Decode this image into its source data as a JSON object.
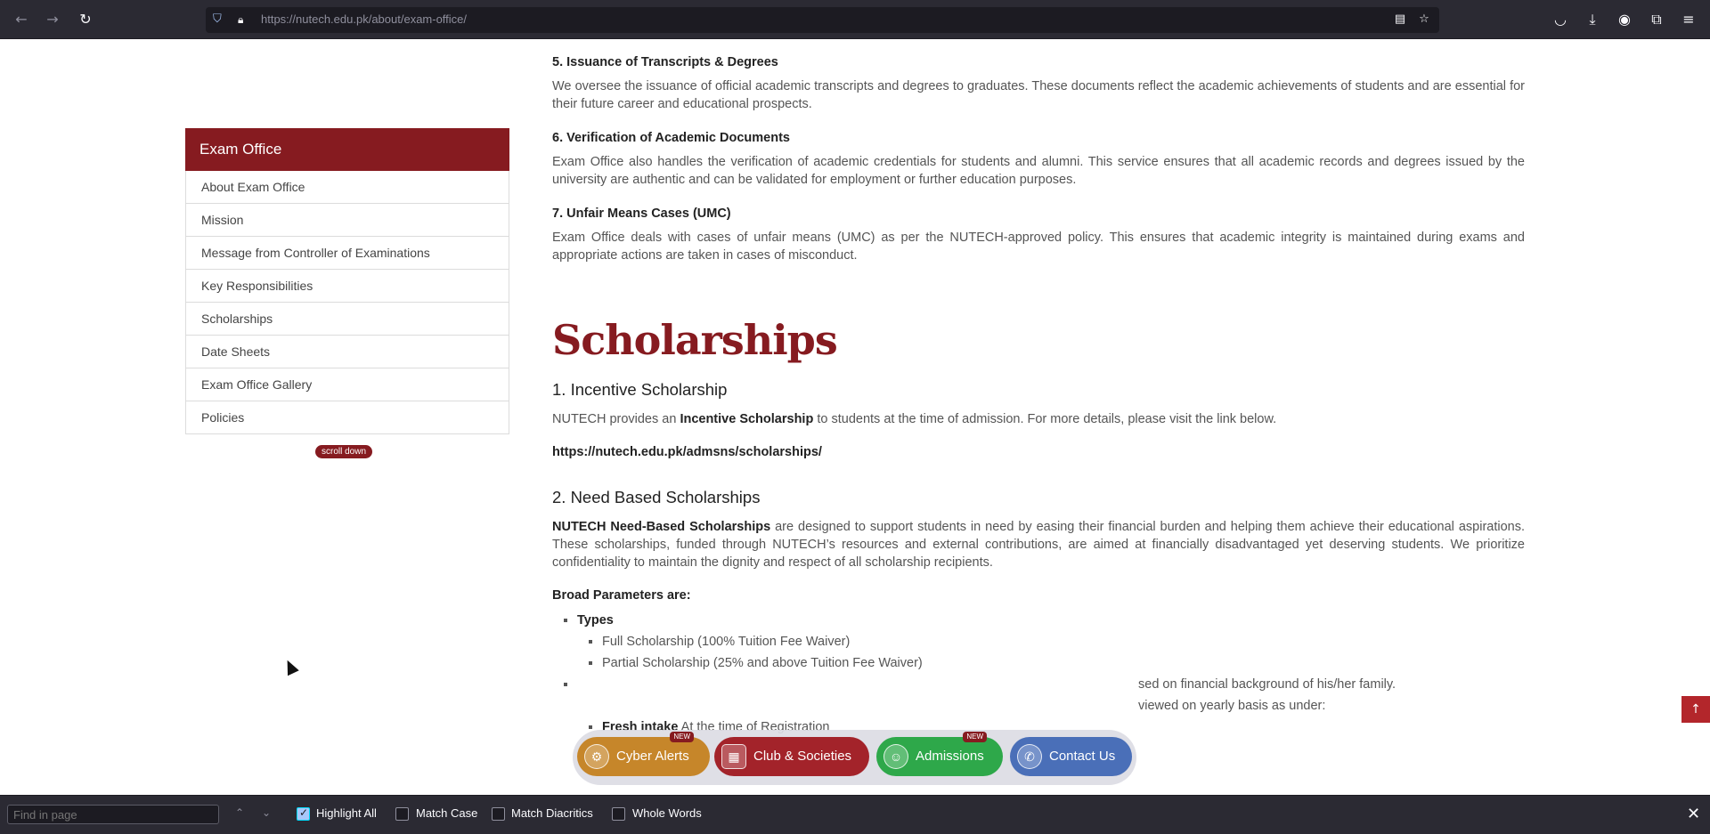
{
  "browser": {
    "url_host": "https://nutech.edu.pk",
    "url_path": "/about/exam-office/",
    "icons": [
      "back-icon",
      "forward-icon",
      "reload-icon",
      "shield-icon",
      "lock-icon",
      "reader-icon",
      "bookmark-star-icon",
      "pocket-icon",
      "download-icon",
      "account-icon",
      "extensions-icon",
      "menu-icon"
    ]
  },
  "sidebar": {
    "title": "Exam Office",
    "items": [
      {
        "label": "About Exam Office"
      },
      {
        "label": "Mission"
      },
      {
        "label": "Message from Controller of Examinations"
      },
      {
        "label": "Key Responsibilities"
      },
      {
        "label": "Scholarships"
      },
      {
        "label": "Date Sheets"
      },
      {
        "label": "Exam Office Gallery"
      },
      {
        "label": "Policies"
      }
    ],
    "scroll_pill": "scroll down"
  },
  "content": {
    "sec5_title": "5. Issuance of Transcripts & Degrees",
    "sec5_text": "We oversee the issuance of official academic transcripts and degrees to graduates. These documents reflect the academic achievements of students and are essential for their future career and educational prospects.",
    "sec6_title": "6. Verification of Academic Documents",
    "sec6_text": "Exam Office also handles the verification of academic credentials for students and alumni. This service ensures that all academic records and degrees issued by the university are authentic and can be validated for employment or further education purposes.",
    "sec7_title": "7. Unfair Means Cases (UMC)",
    "sec7_text": "Exam Office deals with cases of unfair means (UMC) as per the NUTECH-approved policy. This ensures that academic integrity is maintained during exams and appropriate actions are taken in cases of misconduct.",
    "scholarships_title": "Scholarships",
    "incentive_title": "1. Incentive Scholarship",
    "incentive_pre": "NUTECH provides an ",
    "incentive_bold": "Incentive Scholarship",
    "incentive_post": " to students at the time of admission. For more details, please visit the link below.",
    "incentive_link": "https://nutech.edu.pk/admsns/scholarships/",
    "need_title": "2. Need Based Scholarships",
    "need_bold": "NUTECH Need-Based Scholarships",
    "need_text": " are designed to support students in need by easing their financial burden and helping them achieve their educational aspirations. These scholarships, funded through NUTECH’s resources and external contributions, are aimed at financially disadvantaged yet deserving students. We prioritize confidentiality to maintain the dignity and respect of all scholarship recipients.",
    "broad_params": "Broad Parameters are:",
    "types_label": "Types",
    "type_full": "Full Scholarship (100% Tuition Fee Waiver)",
    "type_partial": "Partial Scholarship (25% and above Tuition Fee Waiver)",
    "hidden_line1_tail": "sed on financial background of his/her family.",
    "hidden_line2_tail": "viewed on yearly basis as under:",
    "fresh_intake_bold": "Fresh intake",
    "fresh_intake_rest": " At the time of Registration"
  },
  "floatbar": {
    "buttons": [
      {
        "label": "Cyber Alerts",
        "badge": "NEW",
        "color": "#c6862a"
      },
      {
        "label": "Club & Societies",
        "badge": "",
        "color": "#a3232a"
      },
      {
        "label": "Admissions",
        "badge": "NEW",
        "color": "#2ea84a"
      },
      {
        "label": "Contact Us",
        "badge": "",
        "color": "#4a6fb8"
      }
    ]
  },
  "findbar": {
    "placeholder": "Find in page",
    "options": [
      {
        "label": "Highlight All",
        "checked": true
      },
      {
        "label": "Match Case",
        "checked": false
      },
      {
        "label": "Match Diacritics",
        "checked": false
      },
      {
        "label": "Whole Words",
        "checked": false
      }
    ]
  },
  "colors": {
    "brand": "#861b20",
    "browser_bg": "#2b2a33"
  }
}
